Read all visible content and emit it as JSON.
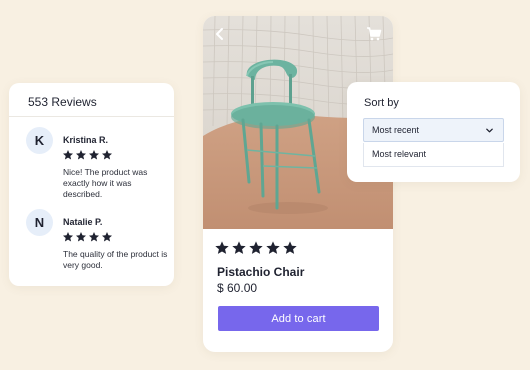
{
  "reviews": {
    "title": "553 Reviews",
    "items": [
      {
        "initial": "K",
        "name": "Kristina R.",
        "stars": 4,
        "text": "Nice! The product was exactly how it was described."
      },
      {
        "initial": "N",
        "name": "Natalie P.",
        "stars": 4,
        "text": "The quality of the product is very good."
      }
    ]
  },
  "product": {
    "rating": 5,
    "name": "Pistachio Chair",
    "price": "$ 60.00",
    "add_to_cart_label": "Add to cart",
    "icons": {
      "back": "chevron-left-icon",
      "cart": "cart-icon"
    }
  },
  "sort": {
    "label": "Sort by",
    "selected": "Most recent",
    "options": [
      "Most relevant"
    ]
  },
  "colors": {
    "background": "#f8f0e2",
    "accent": "#7767ec",
    "star": "#1f2230",
    "avatar_bg": "#e6eef9",
    "select_bg": "#eef3fa"
  }
}
